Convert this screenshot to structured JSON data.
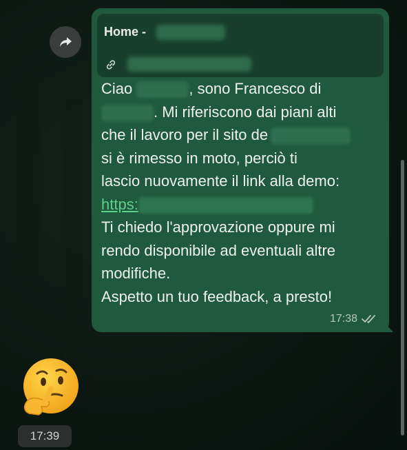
{
  "chat": {
    "message": {
      "preview_title": "Home -",
      "lines": [
        {
          "before": "Ciao",
          "after": ", sono Francesco di"
        },
        {
          "after": ". Mi riferiscono dai piani alti"
        },
        {
          "before": "che il lavoro per il sito de"
        },
        {
          "text": "si è rimesso in moto, perciò ti"
        },
        {
          "text": "lascio nuovamente il link alla demo:"
        },
        {
          "link": "https:"
        },
        {
          "text": "Ti chiedo l'approvazione oppure mi"
        },
        {
          "text": "rendo disponibile ad eventuali altre"
        },
        {
          "text": "modifiche."
        },
        {
          "text": "Aspetto un tuo feedback, a presto!"
        }
      ],
      "time": "17:38",
      "status_icon": "double-check-icon"
    },
    "reply": {
      "emoji": "thinking-face",
      "time": "17:39"
    }
  },
  "colors": {
    "bubble": "#1f5a3e",
    "link": "#5fd08a"
  }
}
